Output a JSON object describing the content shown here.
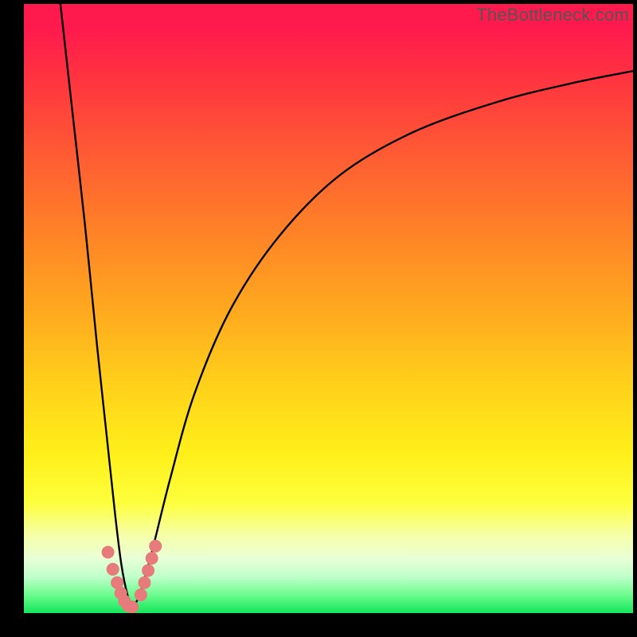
{
  "watermark": "TheBottleneck.com",
  "colors": {
    "frame": "#000000",
    "curve": "#000000",
    "marker_fill": "#e77a7a",
    "marker_stroke": "#d96666"
  },
  "chart_data": {
    "type": "line",
    "title": "",
    "xlabel": "",
    "ylabel": "",
    "xlim": [
      0,
      100
    ],
    "ylim": [
      0,
      100
    ],
    "grid": false,
    "series": [
      {
        "name": "left-branch",
        "x": [
          6,
          8,
          10,
          12,
          13.5,
          15,
          16,
          17,
          17.8
        ],
        "y": [
          100,
          82,
          64,
          44,
          30,
          16,
          8,
          3,
          1
        ]
      },
      {
        "name": "right-branch",
        "x": [
          17.8,
          19,
          21,
          24,
          28,
          34,
          42,
          52,
          64,
          78,
          90,
          100
        ],
        "y": [
          1,
          3,
          10,
          22,
          36,
          50,
          62,
          72,
          79,
          84,
          87,
          89
        ]
      }
    ],
    "markers": [
      {
        "x": 13.8,
        "y": 10.0
      },
      {
        "x": 14.6,
        "y": 7.2
      },
      {
        "x": 15.3,
        "y": 5.0
      },
      {
        "x": 15.9,
        "y": 3.3
      },
      {
        "x": 16.5,
        "y": 2.0
      },
      {
        "x": 17.1,
        "y": 1.2
      },
      {
        "x": 17.8,
        "y": 1.0
      },
      {
        "x": 19.2,
        "y": 3.0
      },
      {
        "x": 19.8,
        "y": 5.0
      },
      {
        "x": 20.4,
        "y": 7.0
      },
      {
        "x": 21.0,
        "y": 9.0
      },
      {
        "x": 21.6,
        "y": 11.0
      }
    ],
    "marker_radius_px": 8
  }
}
